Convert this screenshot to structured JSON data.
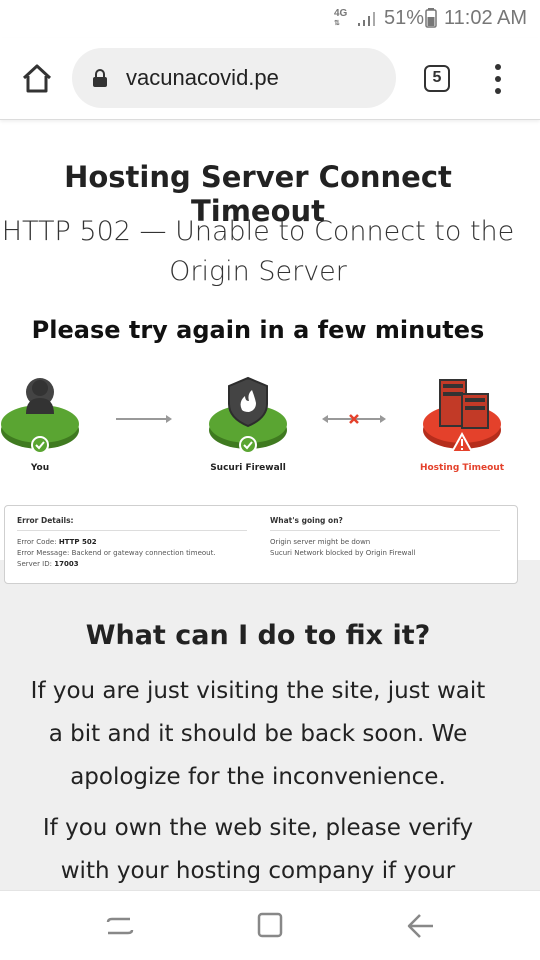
{
  "status_bar": {
    "network": "4G",
    "battery_percent": "51%",
    "time": "11:02 AM"
  },
  "browser": {
    "url": "vacunacovid.pe",
    "tab_count": "5",
    "icons": [
      "home-icon",
      "lock-icon",
      "tabs-icon",
      "more-vert-icon"
    ]
  },
  "page": {
    "title": "Hosting Server Connect Timeout",
    "subtitle": "HTTP 502 — Unable to Connect to the Origin Server",
    "retry": "Please try again in a few minutes"
  },
  "diagram": {
    "nodes": [
      {
        "label": "You",
        "status": "ok"
      },
      {
        "label": "Sucuri Firewall",
        "status": "ok"
      },
      {
        "label": "Hosting Timeout",
        "status": "error"
      }
    ],
    "colors": {
      "ok": "#5aa532",
      "error": "#e4412b"
    }
  },
  "error_details": {
    "title": "Error Details:",
    "code_label": "Error Code:",
    "code": "HTTP 502",
    "message_label": "Error Message:",
    "message": "Backend or gateway connection timeout.",
    "server_label": "Server ID:",
    "server_id": "17003"
  },
  "whats_going_on": {
    "title": "What's going on?",
    "items": [
      "Origin server might be down",
      "Sucuri Network blocked by Origin Firewall"
    ]
  },
  "fix": {
    "heading": "What can I do to fix it?",
    "paragraph1": "If you are just visiting the site, just wait a bit and it should be back soon. We apologize for the inconvenience.",
    "paragraph2": "If you own the web site, please verify with your hosting company if your"
  },
  "nav": {
    "icons": [
      "recents-icon",
      "home-square-icon",
      "back-arrow-icon"
    ]
  }
}
